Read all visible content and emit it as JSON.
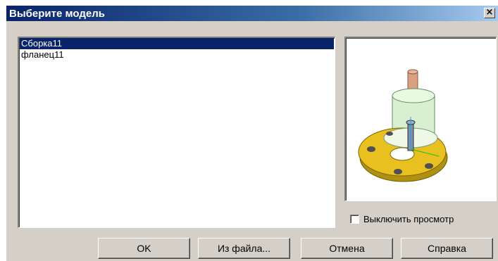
{
  "dialog": {
    "title": "Выберите модель",
    "close_glyph": "×"
  },
  "models": [
    {
      "label": "Сборка11",
      "selected": true
    },
    {
      "label": "фланец11",
      "selected": false
    }
  ],
  "preview": {
    "disable_label": "Выключить просмотр",
    "disable_checked": false,
    "image": "3d-flange-assembly-preview",
    "colors": {
      "flange": "#e8c020",
      "body": "#d8f0d0",
      "shaft": "#d8a080",
      "bolt": "#8090a0"
    }
  },
  "buttons": {
    "ok": "OK",
    "from_file": "Из файла...",
    "cancel": "Отмена",
    "help": "Справка"
  }
}
